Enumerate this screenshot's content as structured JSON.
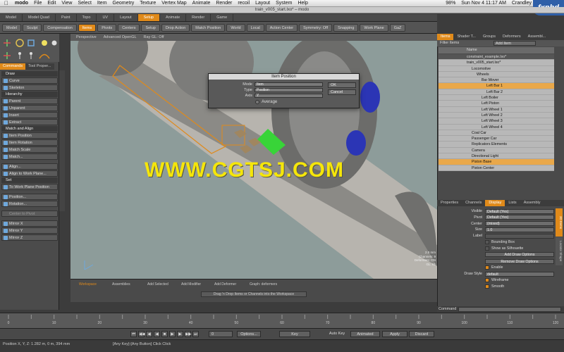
{
  "menubar": {
    "apple": "",
    "app": "modo",
    "items": [
      "File",
      "Edit",
      "View",
      "Select",
      "Item",
      "Geometry",
      "Texture",
      "Vertex Map",
      "Animate",
      "Render",
      "recoil",
      "Layout",
      "System",
      "Help"
    ],
    "battery": "98%",
    "clock": "Sun Nov 4  11:17 AM",
    "user": "Crandley"
  },
  "window_title": "train_v005_start.lxo* – modo",
  "watermark_logo": "fxphd",
  "layout_tabs": [
    "Model",
    "Model Quad",
    "Paint",
    "Topo",
    "UV",
    "Layout",
    "Setup",
    "Animate",
    "Render",
    "Game"
  ],
  "layout_active": "Setup",
  "toolbar": {
    "model": "Model",
    "sculpt": "Sculpt",
    "compensation": "Compensation",
    "items": "Items",
    "pivots": "Pivots",
    "centers": "Centers",
    "setup": "Setup",
    "drop_action": "Drop Action",
    "match_position": "Match Position",
    "world": "World",
    "local": "Local",
    "action_center": "Action Center",
    "symmetry": "Symmetry: Off",
    "snapping": "Snapping",
    "work_plane": "Work Plane",
    "gl": "GaZ"
  },
  "left_tabs": [
    "Commands",
    "Tool Proper..."
  ],
  "tools": {
    "draw_section": "Draw",
    "curve": "Curve",
    "skeleton": "Skeleton",
    "hierarchy_section": "Hierarchy",
    "parent": "Parent",
    "unparent": "Unparent",
    "insert": "Insert",
    "extract": "Extract",
    "match_section": "Match and Align",
    "item_position": "Item Position",
    "item_rotation": "Item Rotation",
    "match_scale": "Match Scale",
    "match": "Match...",
    "align": "Align...",
    "align_work_plane": "Align to Work Plane...",
    "set_section": "Set",
    "to_work_plane_position": "To Work Plane Position",
    "position": "Position...",
    "rotation": "Rotation...",
    "center_to_pivot": "Center to Pivot",
    "mirror_x": "Mirror X",
    "mirror_y": "Mirror Y",
    "mirror_z": "Mirror Z"
  },
  "viewport": {
    "perspective": "Perspective",
    "gl_mode": "Advanced OpenGL",
    "ray_gl": "Ray GL: Off",
    "stats": [
      "2.0 mm",
      "Channels: 9",
      "Deformers: ON",
      "GL: 61"
    ]
  },
  "site_watermark": "WWW.CGTSJ.COM",
  "dialog": {
    "title": "Item Position",
    "mode_label": "Mode",
    "mode_value": "Item",
    "type_label": "Type",
    "type_value": "Position",
    "axis_label": "Axis",
    "axis_value": "Y",
    "average_label": "Average",
    "ok": "OK",
    "cancel": "Cancel"
  },
  "workspace_tabs": [
    "Workspace",
    "Assemblies",
    "Add Selected",
    "Add Modifier",
    "Add Deformer",
    "Graph: deformers"
  ],
  "workspace_msg": "Drag 'n Drop Items or Channels into the Workspace",
  "right_tabs": [
    "Items",
    "Shader T...",
    "Groups",
    "Deformers",
    "Assembl..."
  ],
  "filter_items": "Filter Items",
  "add_item": "Add Item",
  "tree_header": "Name",
  "tree": [
    {
      "label": "constraint_example.lxo*",
      "indent": 0,
      "cls": "dark"
    },
    {
      "label": "train_v005_start.lxo*",
      "indent": 0,
      "cls": ""
    },
    {
      "label": "Locomotive",
      "indent": 1,
      "cls": ""
    },
    {
      "label": "Wheels",
      "indent": 2,
      "cls": ""
    },
    {
      "label": "Bar Mover",
      "indent": 3,
      "cls": ""
    },
    {
      "label": "Left Bar 1",
      "indent": 4,
      "cls": "sel"
    },
    {
      "label": "Left Bar 2",
      "indent": 4,
      "cls": ""
    },
    {
      "label": "Left Boiler",
      "indent": 3,
      "cls": ""
    },
    {
      "label": "Left Piston",
      "indent": 3,
      "cls": ""
    },
    {
      "label": "Left Wheel 1",
      "indent": 3,
      "cls": ""
    },
    {
      "label": "Left Wheel 2",
      "indent": 3,
      "cls": ""
    },
    {
      "label": "Left Wheel 3",
      "indent": 3,
      "cls": ""
    },
    {
      "label": "Left Wheel 4",
      "indent": 3,
      "cls": ""
    },
    {
      "label": "Coal Car",
      "indent": 1,
      "cls": ""
    },
    {
      "label": "Passenger Car",
      "indent": 1,
      "cls": ""
    },
    {
      "label": "Replicators Elements",
      "indent": 1,
      "cls": ""
    },
    {
      "label": "Camera",
      "indent": 1,
      "cls": ""
    },
    {
      "label": "Directional Light",
      "indent": 1,
      "cls": ""
    },
    {
      "label": "Piston Base",
      "indent": 1,
      "cls": "sel"
    },
    {
      "label": "Piston Center",
      "indent": 1,
      "cls": ""
    }
  ],
  "prop_tabs": [
    "Properties",
    "Channels",
    "Display",
    "Lists",
    "Assembly"
  ],
  "prop_active": "Display",
  "props": {
    "visible_label": "Visible",
    "visible_value": "Default (Yes)",
    "pivot_label": "Pivot",
    "pivot_value": "Default (Yes)",
    "center_label": "Center",
    "center_value": "(mixed)",
    "size_label": "Size",
    "size_value": "1.0",
    "label_label": "Label",
    "bounding_box": "Bounding Box",
    "show_silhouette": "Show as Silhouette",
    "add_draw_options": "Add Draw Options",
    "remove_draw_options": "Remove Draw Options",
    "enable": "Enable",
    "draw_style_label": "Draw Style",
    "draw_style_value": "default",
    "wireframe": "Wireframe",
    "smooth": "Smooth"
  },
  "side_tabs": [
    "3D Items",
    "Locator Shape"
  ],
  "command_label": "Command",
  "timeline_ticks": [
    "0",
    "",
    "10",
    "",
    "20",
    "",
    "30",
    "",
    "40",
    "",
    "50",
    "",
    "60",
    "",
    "70",
    "",
    "80",
    "",
    "90",
    "",
    "100",
    "",
    "110",
    "",
    "120"
  ],
  "playbar": {
    "frame": "0",
    "options": "Options...",
    "key": "Key",
    "auto_key": "Auto Key",
    "animated": "Animated",
    "apply": "Apply",
    "discard": "Discard"
  },
  "status": {
    "position": "Position X, Y, Z:  1.282 m, 0 m, 394 mm",
    "hint": "[Any Key]-[Any Button] Click   Click"
  },
  "colors": {
    "accent": "#e08a1a",
    "panel": "#4a4a4a",
    "viewport": "#8a9a98",
    "selection": "#e9a84a",
    "cyan": "#00a0e0"
  }
}
